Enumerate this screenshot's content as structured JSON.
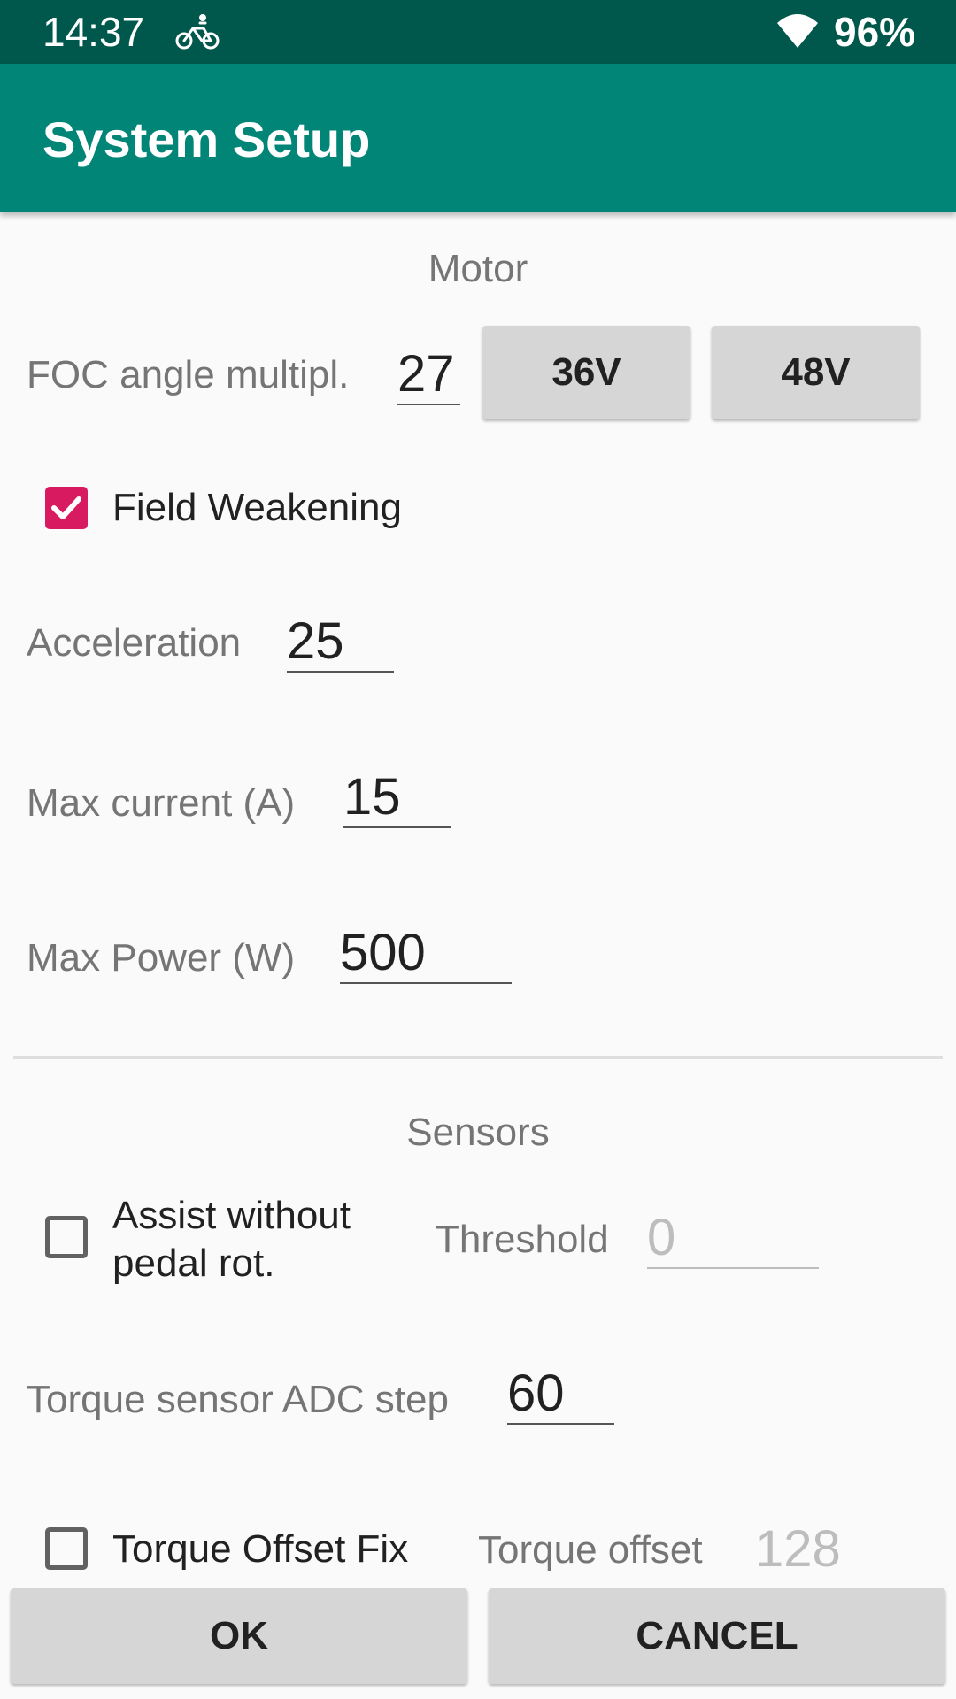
{
  "status_bar": {
    "time": "14:37",
    "battery": "96%",
    "icons": [
      "bike-icon",
      "wifi-icon"
    ]
  },
  "app_bar": {
    "title": "System Setup",
    "color": "#008577",
    "status_color": "#00574b"
  },
  "motor": {
    "title": "Motor",
    "foc_label": "FOC angle multipl.",
    "foc_value": "27",
    "btn_36v": "36V",
    "btn_48v": "48V",
    "field_weakening_label": "Field Weakening",
    "field_weakening_checked": true,
    "acceleration_label": "Acceleration",
    "acceleration_value": "25",
    "max_current_label": "Max current (A)",
    "max_current_value": "15",
    "max_power_label": "Max Power (W)",
    "max_power_value": "500"
  },
  "sensors": {
    "title": "Sensors",
    "assist_label_line1": "Assist without",
    "assist_label_line2": "pedal rot.",
    "assist_checked": false,
    "threshold_label": "Threshold",
    "threshold_value": "0",
    "torque_adc_label": "Torque sensor ADC step",
    "torque_adc_value": "60",
    "torque_offset_fix_label": "Torque Offset Fix",
    "torque_offset_fix_checked": false,
    "torque_offset_label": "Torque offset",
    "torque_offset_value": "128"
  },
  "actions": {
    "ok": "OK",
    "cancel": "CANCEL"
  },
  "colors": {
    "accent": "#d81b60"
  }
}
